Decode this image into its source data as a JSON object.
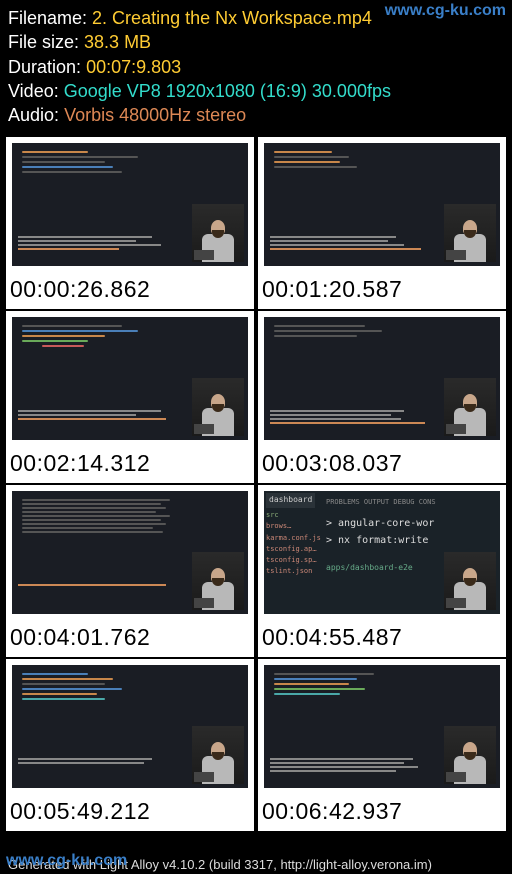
{
  "watermark": "www.cg-ku.com",
  "header": {
    "filename_label": "Filename:",
    "filename_value": "2. Creating the Nx Workspace.mp4",
    "filesize_label": "File size:",
    "filesize_value": "38.3 MB",
    "duration_label": "Duration:",
    "duration_value": "00:07:9.803",
    "video_label": "Video:",
    "video_value": "Google VP8 1920x1080 (16:9) 30.000fps",
    "audio_label": "Audio:",
    "audio_value": "Vorbis 48000Hz stereo"
  },
  "thumbnails": [
    {
      "timestamp": "00:00:26.862"
    },
    {
      "timestamp": "00:01:20.587"
    },
    {
      "timestamp": "00:02:14.312"
    },
    {
      "timestamp": "00:03:08.037"
    },
    {
      "timestamp": "00:04:01.762"
    },
    {
      "timestamp": "00:04:55.487"
    },
    {
      "timestamp": "00:05:49.212"
    },
    {
      "timestamp": "00:06:42.937"
    }
  ],
  "thumb6": {
    "tab": "dashboard",
    "sidebar_items": [
      "src",
      "brows…",
      "karma.conf.js",
      "tsconfig.ap…",
      "tsconfig.sp…",
      "tslint.json"
    ],
    "tabs_row": "PROBLEMS   OUTPUT   DEBUG CONS",
    "cmd1": "> angular-core-wor",
    "cmd2": "> nx format:write",
    "footer_path": "apps/dashboard-e2e"
  },
  "footer": "Generated with Light Alloy v4.10.2 (build 3317, http://light-alloy.verona.im)"
}
